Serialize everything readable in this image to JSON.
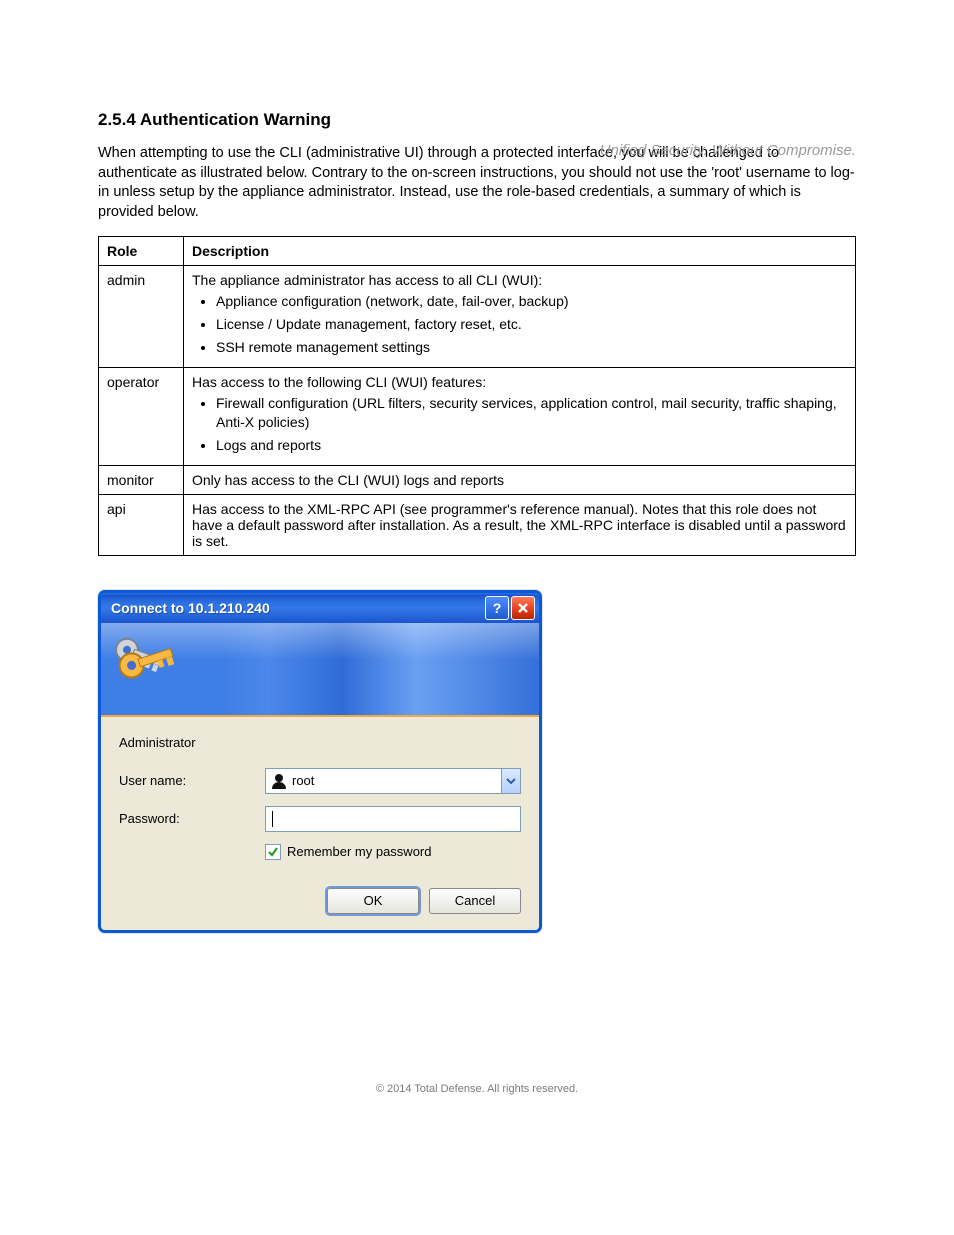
{
  "tagline": "Unified Security. Without Compromise.",
  "section_heading": "2.5.4 Authentication Warning",
  "intro_para": "When attempting to use the CLI (administrative UI) through a protected interface, you will be challenged to authenticate as illustrated below. Contrary to the on-screen instructions, you should not use the 'root' username to log-in unless setup by the appliance administrator. Instead, use the role-based credentials, a summary of which is provided below.",
  "table": {
    "headers": [
      "Role",
      "Description"
    ],
    "rows": [
      {
        "role": "admin",
        "desc_intro": "The appliance administrator has access to all CLI (WUI):",
        "items": [
          "Appliance configuration (network, date, fail-over, backup)",
          "License / Update management, factory reset, etc.",
          "SSH remote management settings"
        ]
      },
      {
        "role": "operator",
        "desc_intro": "Has access to the following CLI (WUI) features:",
        "items": [
          "Firewall configuration (URL filters, security services, application control, mail security, traffic shaping, Anti-X policies)",
          "Logs and reports"
        ]
      },
      {
        "role": "monitor",
        "desc_intro": "Only has access to the CLI (WUI) logs and reports"
      },
      {
        "role": "api",
        "desc_intro": "Has access to the XML-RPC API (see programmer's reference manual). Notes that this role does not have a default password after installation. As a result, the XML-RPC interface is disabled until a password is set."
      }
    ]
  },
  "dialog": {
    "title": "Connect to 10.1.210.240",
    "realm": "Administrator",
    "username_label": "User name:",
    "username_value": "root",
    "password_label": "Password:",
    "remember_label": "Remember my password",
    "ok": "OK",
    "cancel": "Cancel"
  },
  "footer": "© 2014 Total Defense. All rights reserved."
}
